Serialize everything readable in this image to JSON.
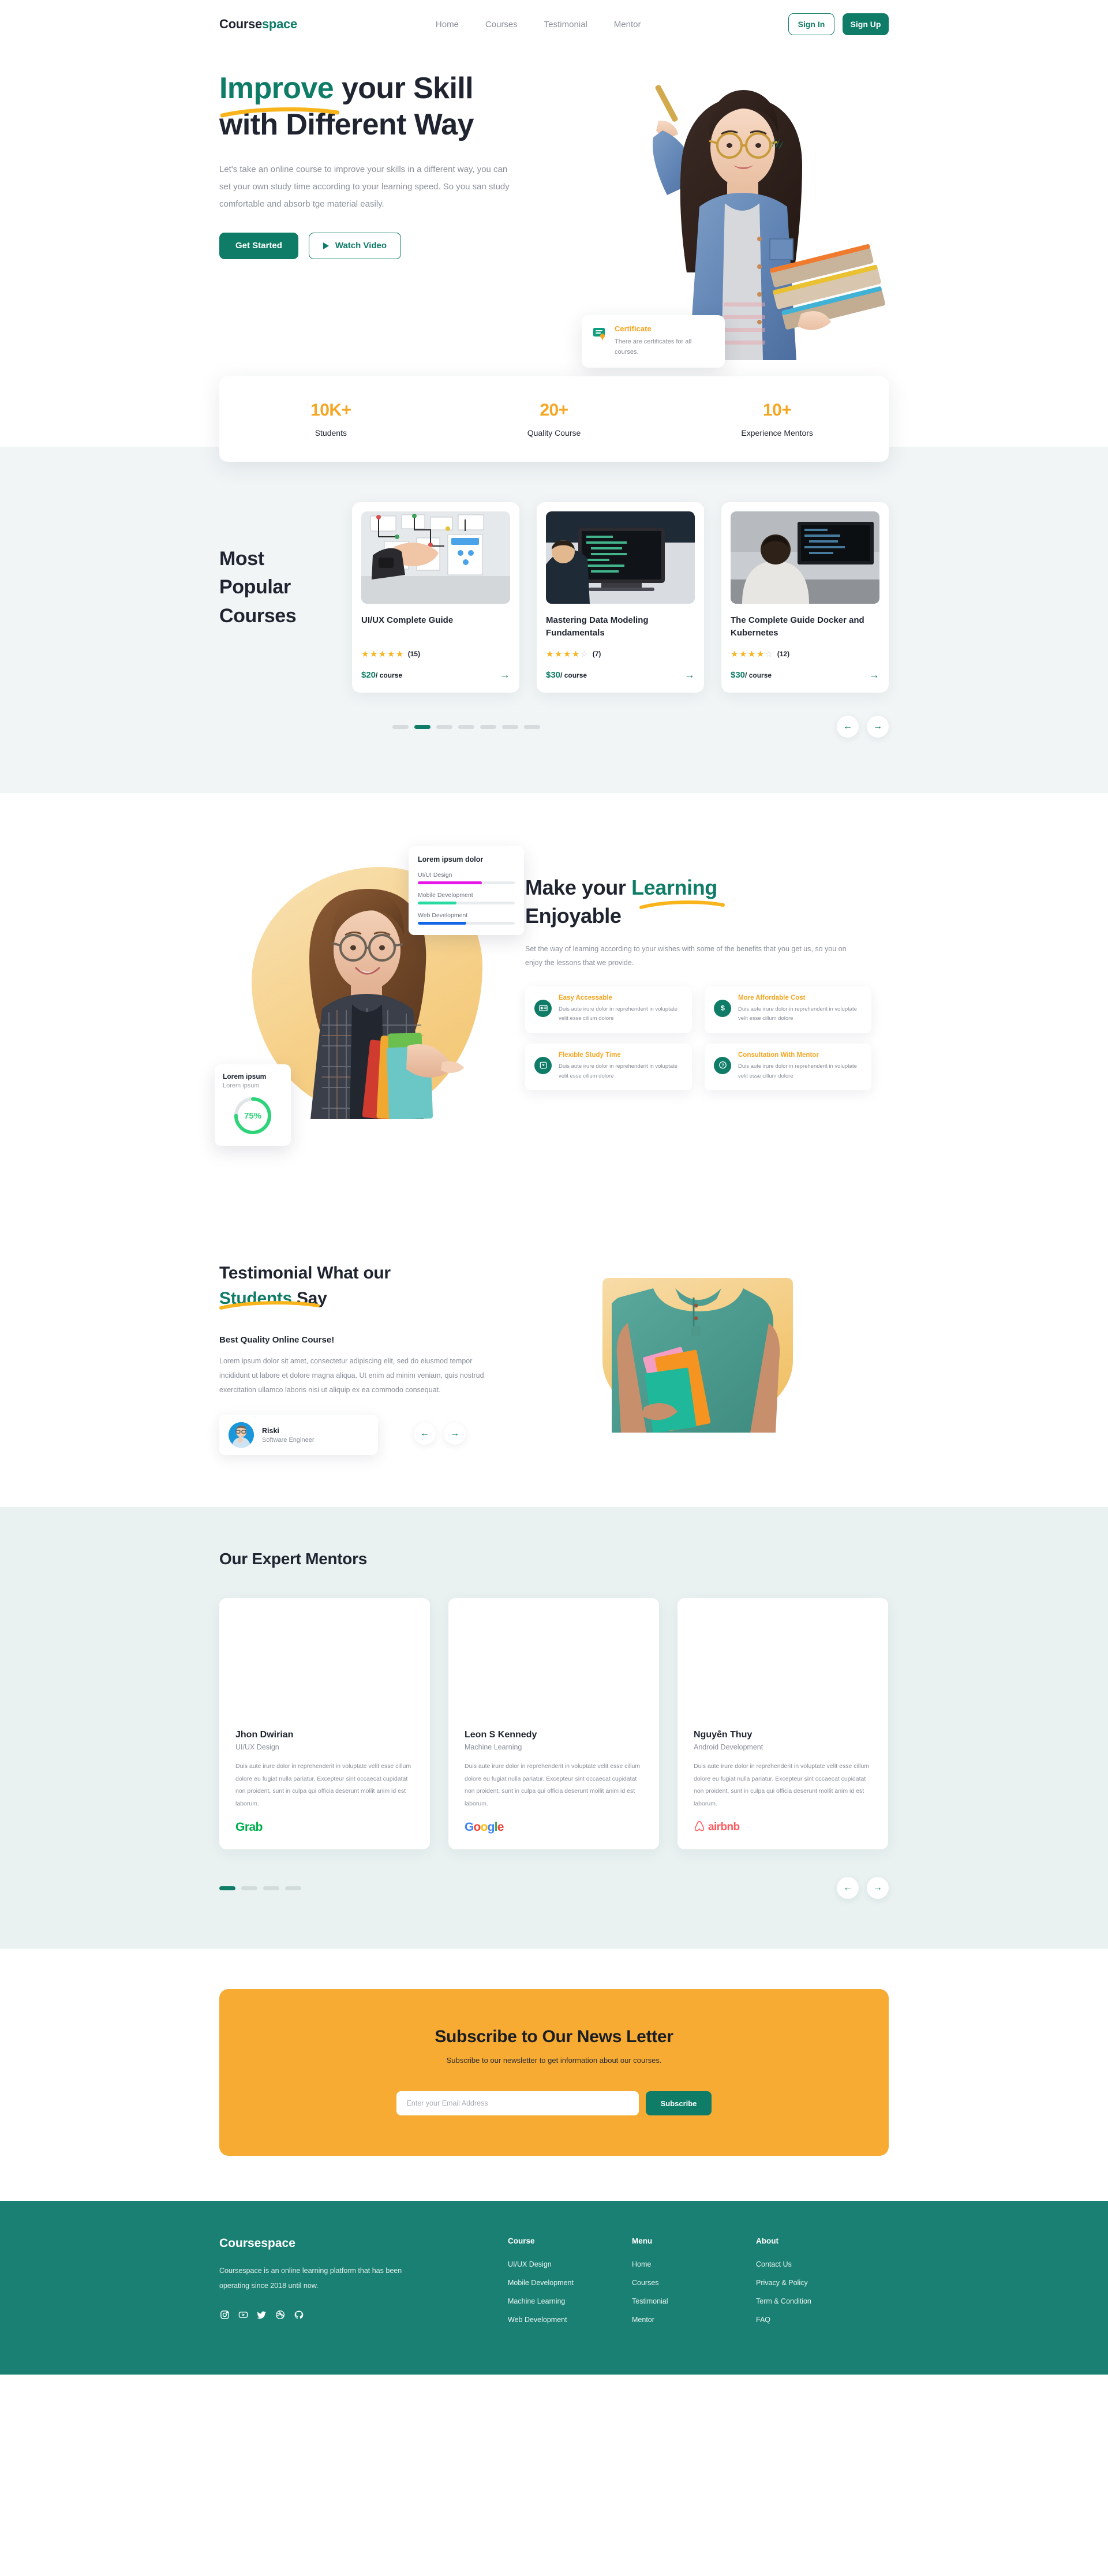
{
  "nav": {
    "logo_part1": "Course",
    "logo_part2": "space",
    "links": [
      {
        "label": "Home"
      },
      {
        "label": "Courses"
      },
      {
        "label": "Testimonial"
      },
      {
        "label": "Mentor"
      }
    ],
    "sign_in": "Sign In",
    "sign_up": "Sign Up"
  },
  "hero": {
    "title_line1_green": "Improve",
    "title_line1_rest": " your Skill",
    "title_line2": "with Different Way",
    "subtitle": "Let's take an online course to improve your skills in a different way, you can set your own study time according to your learning speed. So you san study comfortable and absorb tge material easily.",
    "btn_primary": "Get Started",
    "btn_secondary": "Watch Video",
    "certificate_title": "Certificate",
    "certificate_desc": "There are certificates for all courses."
  },
  "stats": [
    {
      "value": "10K+",
      "label": "Students"
    },
    {
      "value": "20+",
      "label": "Quality Course"
    },
    {
      "value": "10+",
      "label": "Experience Mentors"
    }
  ],
  "courses": {
    "heading_line1": "Most",
    "heading_line2": "Popular",
    "heading_line3": "Courses",
    "items": [
      {
        "name": "UI/UX Complete Guide",
        "stars_filled": 5,
        "stars_total": 5,
        "rating_count": "(15)",
        "price": "$20",
        "per": "/ course"
      },
      {
        "name": "Mastering Data Modeling Fundamentals",
        "stars_filled": 4,
        "stars_total": 5,
        "rating_count": "(7)",
        "price": "$30",
        "per": "/ course"
      },
      {
        "name": "The Complete Guide Docker and Kubernetes",
        "stars_filled": 4,
        "stars_total": 5,
        "rating_count": "(12)",
        "price": "$30",
        "per": "/ course"
      }
    ],
    "dots_total": 7,
    "dots_active": 2,
    "prev_icon": "arrow-left",
    "next_icon": "arrow-right"
  },
  "learning": {
    "skills_card_title": "Lorem ipsum dolor",
    "skills": [
      {
        "label": "UI/UI Design",
        "percent": 66,
        "color": "#e815e8"
      },
      {
        "label": "Mobile Development",
        "percent": 40,
        "color": "#28d9a0"
      },
      {
        "label": "Web Development",
        "percent": 50,
        "color": "#1366e8"
      }
    ],
    "progress_title": "Lorem ipsum",
    "progress_subtitle": "Lorem ipsum",
    "progress_value": "75%",
    "progress_percent": 75,
    "progress_color": "#2ed47a",
    "title_part1": "Make your ",
    "title_green": "Learning",
    "title_part2": "Enjoyable",
    "subtitle": "Set the way of learning according to your wishes with some of the benefits that you get us, so you on enjoy the lessons that we provide.",
    "benefits": [
      {
        "icon": "id-card-icon",
        "title": "Easy Accessable",
        "text": "Duis aute irure dolor in reprehenderit in voluptate velit esse cillum dolore"
      },
      {
        "icon": "dollar-icon",
        "title": "More Affordable Cost",
        "text": "Duis aute irure dolor in reprehenderit in voluptate velit esse cillum dolore"
      },
      {
        "icon": "inbox-icon",
        "title": "Flexible Study Time",
        "text": "Duis aute irure dolor in reprehenderit in voluptate velit esse cillum dolore"
      },
      {
        "icon": "question-icon",
        "title": "Consultation With Mentor",
        "text": "Duis aute irure dolor in reprehenderit in voluptate velit esse cillum dolore"
      }
    ]
  },
  "testimonial": {
    "title_part1": "Testimonial What our",
    "title_green": "Students",
    "title_part2": " Say",
    "quote_title": "Best Quality Online Course!",
    "quote_body": "Lorem ipsum dolor sit amet, consectetur adipiscing elit, sed do eiusmod tempor incididunt ut labore et dolore magna aliqua. Ut enim ad minim veniam, quis nostrud exercitation ullamco laboris nisi ut aliquip ex ea commodo consequat.",
    "author_name": "Riski",
    "author_role": "Software Engineer",
    "prev_icon": "arrow-left",
    "next_icon": "arrow-right"
  },
  "mentors": {
    "title": "Our Expert Mentors",
    "items": [
      {
        "name": "Jhon Dwirian",
        "role": "UI/UX Design",
        "text": "Duis aute irure dolor in reprehenderit in voluptate velit esse cillum dolore eu fugiat nulla pariatur. Excepteur sint occaecat cupidatat non proident, sunt in culpa qui officia deserunt mollit anim id est laborum.",
        "company": "Grab"
      },
      {
        "name": "Leon S Kennedy",
        "role": "Machine Learning",
        "text": "Duis aute irure dolor in reprehenderit in voluptate velit esse cillum dolore eu fugiat nulla pariatur. Excepteur sint occaecat cupidatat non proident, sunt in culpa qui officia deserunt mollit anim id est laborum.",
        "company": "Google"
      },
      {
        "name": "Nguyễn Thuy",
        "role": "Android Development",
        "text": "Duis aute irure dolor in reprehenderit in voluptate velit esse cillum dolore eu fugiat nulla pariatur. Excepteur sint occaecat cupidatat non proident, sunt in culpa qui officia deserunt mollit anim id est laborum.",
        "company": "airbnb"
      }
    ],
    "dots_total": 4,
    "dots_active": 1
  },
  "newsletter": {
    "title": "Subscribe to Our News Letter",
    "subtitle": "Subscribe to our newsletter to get information about our courses.",
    "input_placeholder": "Enter your Email Address",
    "input_value": "",
    "button": "Subscribe"
  },
  "footer": {
    "logo": "Coursespace",
    "description": "Coursespace is an online learning platform that has been operating since 2018 until now.",
    "social": [
      {
        "icon": "instagram-icon"
      },
      {
        "icon": "youtube-icon"
      },
      {
        "icon": "twitter-icon"
      },
      {
        "icon": "dribbble-icon"
      },
      {
        "icon": "github-icon"
      }
    ],
    "columns": [
      {
        "heading": "Course",
        "links": [
          {
            "label": "UI/UX Design"
          },
          {
            "label": "Mobile Development"
          },
          {
            "label": "Machine Learning"
          },
          {
            "label": "Web Development"
          }
        ]
      },
      {
        "heading": "Menu",
        "links": [
          {
            "label": "Home"
          },
          {
            "label": "Courses"
          },
          {
            "label": "Testimonial"
          },
          {
            "label": "Mentor"
          }
        ]
      },
      {
        "heading": "About",
        "links": [
          {
            "label": "Contact Us"
          },
          {
            "label": "Privacy & Policy"
          },
          {
            "label": "Term & Condition"
          },
          {
            "label": "FAQ"
          }
        ]
      }
    ]
  },
  "colors": {
    "primary": "#0e7c66",
    "accent": "#f5a623",
    "newsletter_bg": "#f7ab33",
    "footer_bg": "#1a8073",
    "courses_bg": "#f1f5f6",
    "mentors_bg": "#e9f2f1"
  }
}
